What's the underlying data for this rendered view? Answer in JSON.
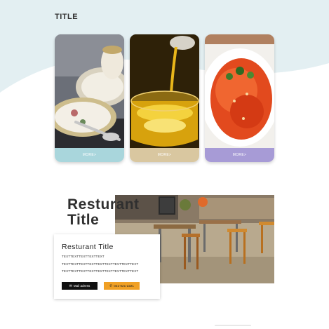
{
  "page": {
    "title": "TITLE"
  },
  "cards": [
    {
      "image": "porcelain-teacup-photo",
      "more_label": "MORE>",
      "accent": "#a9d6dc"
    },
    {
      "image": "olive-oil-pour-photo",
      "more_label": "MORE>",
      "accent": "#d9c7a0"
    },
    {
      "image": "pasta-dish-photo",
      "more_label": "MORE>",
      "accent": "#a79bd6"
    }
  ],
  "restaurant": {
    "big_title_line1": "Resturant",
    "big_title_line2": "Title",
    "image": "outdoor-cafe-photo",
    "card_title": "Resturant Title",
    "text_lines": [
      "TEXTTEXTTEXTTEXTTEXT",
      "TEXTTEXTTEXTTEXTTEXTTEXTTEXTTEXTTEXT",
      "TEXTTEXTTEXTTEXTTEXTTEXTTEXTTEXTTEXT"
    ],
    "mail_label": "Mail adress",
    "phone_label": "021-021-2221",
    "mail_icon": "envelope-icon",
    "phone_icon": "phone-icon"
  },
  "colors": {
    "wave": "#e3eff2",
    "mail_button": "#111111",
    "phone_button": "#f0a025"
  }
}
